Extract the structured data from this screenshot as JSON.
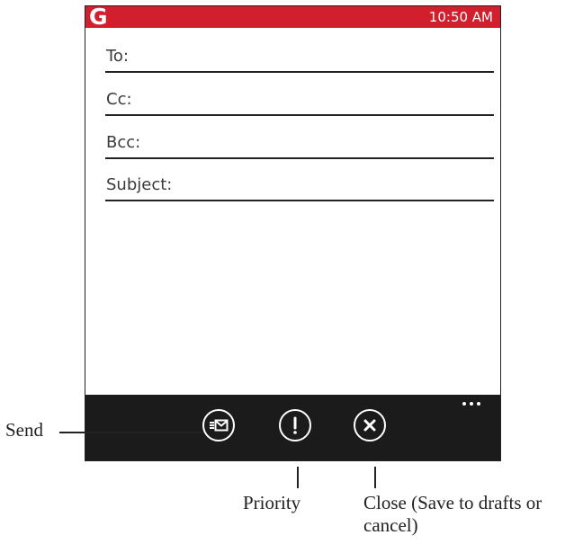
{
  "status_bar": {
    "logo": "G",
    "time": "10:50 AM",
    "accent_color": "#d11f2d"
  },
  "fields": {
    "to_label": "To:",
    "cc_label": "Cc:",
    "bcc_label": "Bcc:",
    "subject_label": "Subject:"
  },
  "app_bar": {
    "background_color": "#1b1b1b",
    "buttons": [
      {
        "icon": "send-mail-icon"
      },
      {
        "icon": "priority-exclamation-icon"
      },
      {
        "icon": "close-x-icon"
      }
    ],
    "more_icon": "ellipsis-icon"
  },
  "callouts": {
    "send": "Send",
    "priority": "Priority",
    "close": "Close (Save to drafts or cancel)"
  }
}
